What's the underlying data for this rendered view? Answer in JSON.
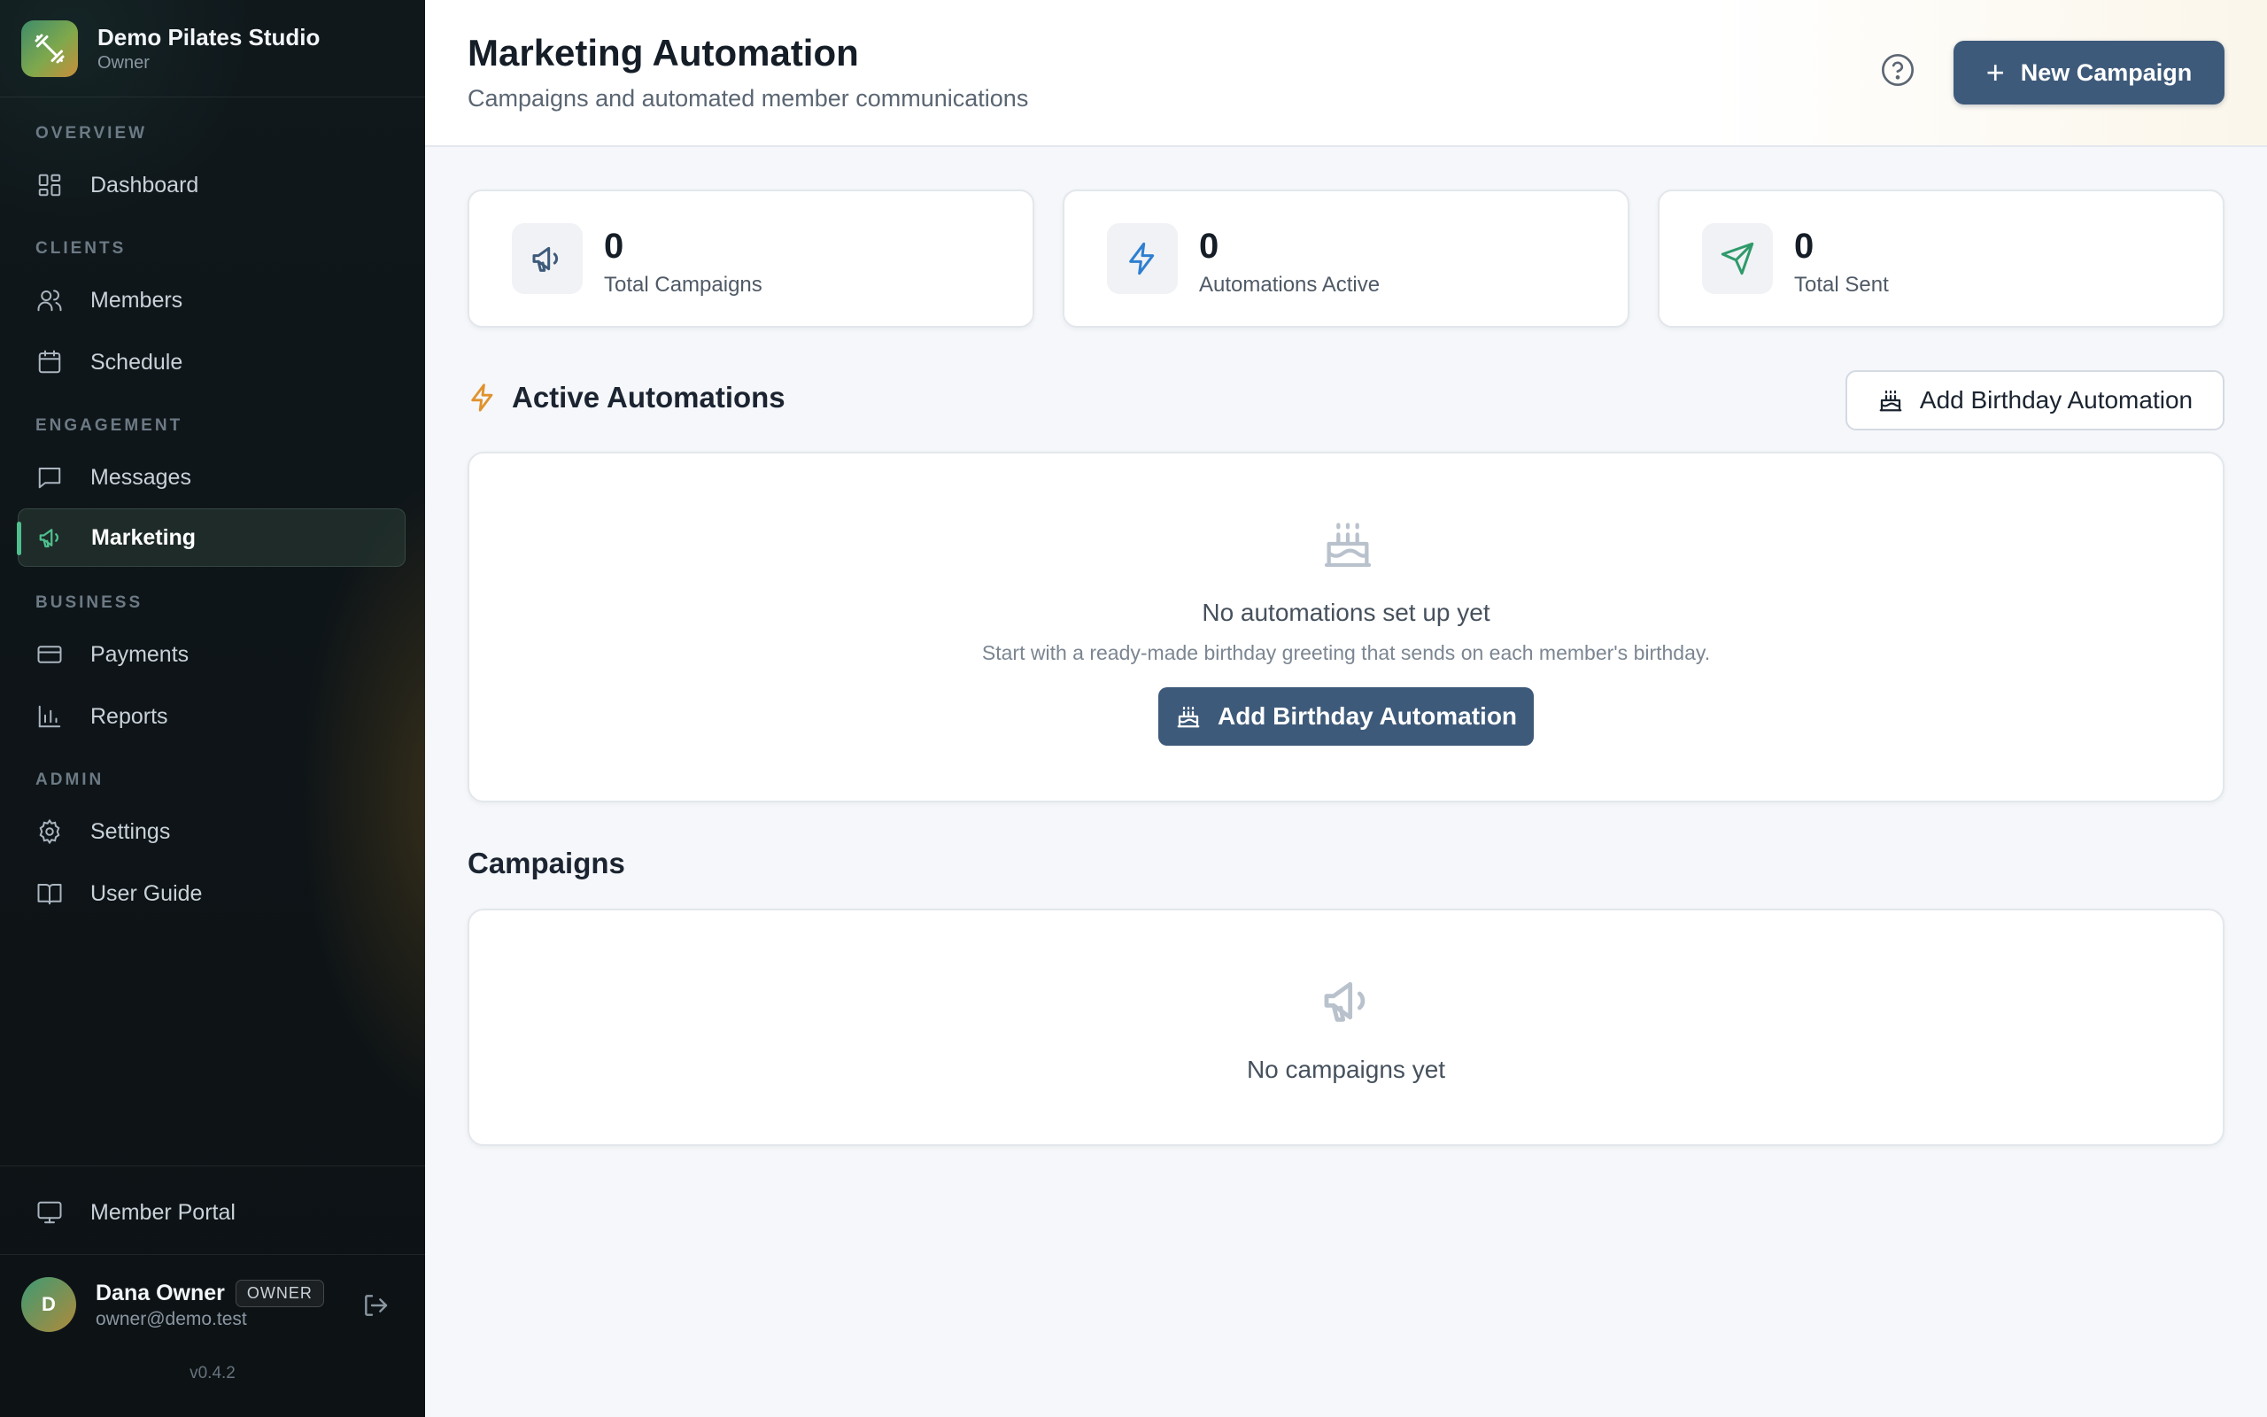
{
  "sidebar": {
    "brand": {
      "name": "Demo Pilates Studio",
      "role": "Owner",
      "logo_icon": "dumbbell-icon"
    },
    "sections": {
      "overview": "OVERVIEW",
      "clients": "CLIENTS",
      "engagement": "ENGAGEMENT",
      "business": "BUSINESS",
      "admin": "ADMIN"
    },
    "items": {
      "dashboard": {
        "label": "Dashboard",
        "icon": "dashboard-icon"
      },
      "members": {
        "label": "Members",
        "icon": "users-icon"
      },
      "schedule": {
        "label": "Schedule",
        "icon": "calendar-icon"
      },
      "messages": {
        "label": "Messages",
        "icon": "message-square-icon"
      },
      "marketing": {
        "label": "Marketing",
        "icon": "megaphone-icon",
        "active": true
      },
      "payments": {
        "label": "Payments",
        "icon": "credit-card-icon"
      },
      "reports": {
        "label": "Reports",
        "icon": "bar-chart-icon"
      },
      "settings": {
        "label": "Settings",
        "icon": "gear-icon"
      },
      "user_guide": {
        "label": "User Guide",
        "icon": "book-icon"
      },
      "member_portal": {
        "label": "Member Portal",
        "icon": "monitor-icon"
      }
    },
    "user": {
      "initial": "D",
      "name": "Dana Owner",
      "badge": "OWNER",
      "email": "owner@demo.test"
    },
    "version": "v0.4.2"
  },
  "header": {
    "title": "Marketing Automation",
    "subtitle": "Campaigns and automated member communications",
    "new_campaign_label": "New Campaign"
  },
  "stats": [
    {
      "value": "0",
      "label": "Total Campaigns",
      "icon": "megaphone-icon",
      "color": "#3e5a7a"
    },
    {
      "value": "0",
      "label": "Automations Active",
      "icon": "lightning-icon",
      "color": "#2f7fd0"
    },
    {
      "value": "0",
      "label": "Total Sent",
      "icon": "send-icon",
      "color": "#2e9a6a"
    }
  ],
  "automations": {
    "title": "Active Automations",
    "add_button_label": "Add Birthday Automation",
    "empty_title": "No automations set up yet",
    "empty_description": "Start with a ready-made birthday greeting that sends on each member's birthday.",
    "empty_button_label": "Add Birthday Automation",
    "accent_color": "#e0922e"
  },
  "campaigns": {
    "title": "Campaigns",
    "empty_title": "No campaigns yet"
  },
  "colors": {
    "primary": "#3e5a7a",
    "sidebar_bg": "#0e1417",
    "active_indicator": "#4fbf8e"
  }
}
